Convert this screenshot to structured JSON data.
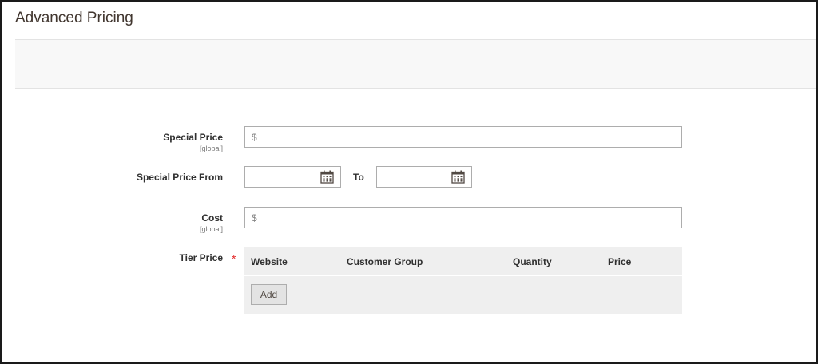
{
  "section": {
    "title": "Advanced Pricing"
  },
  "fields": {
    "special_price": {
      "label": "Special Price",
      "scope": "[global]",
      "prefix": "$",
      "value": ""
    },
    "special_price_from": {
      "label": "Special Price From",
      "from_value": "",
      "to_label": "To",
      "to_value": ""
    },
    "cost": {
      "label": "Cost",
      "scope": "[global]",
      "prefix": "$",
      "value": ""
    },
    "tier_price": {
      "label": "Tier Price",
      "required_mark": "*",
      "columns": [
        "Website",
        "Customer Group",
        "Quantity",
        "Price"
      ],
      "add_label": "Add"
    }
  },
  "icons": {
    "calendar": "calendar-icon"
  },
  "colors": {
    "required": "#e22626",
    "border": "#adadad",
    "panel": "#efefef"
  }
}
